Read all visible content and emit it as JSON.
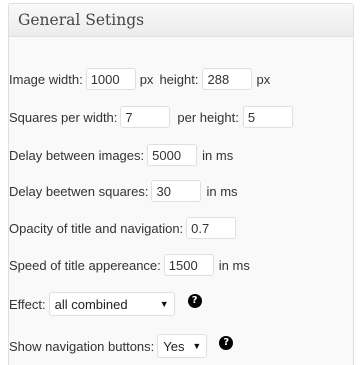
{
  "panel": {
    "title": "General Setings"
  },
  "image_size": {
    "width_label": "Image width:",
    "width_value": "1000",
    "width_unit": "px",
    "height_label": "height:",
    "height_value": "288",
    "height_unit": "px"
  },
  "squares": {
    "per_width_label": "Squares per width:",
    "per_width_value": "7",
    "per_height_label": "per height:",
    "per_height_value": "5"
  },
  "delay_images": {
    "label": "Delay between images:",
    "value": "5000",
    "unit": "in ms"
  },
  "delay_squares": {
    "label": "Delay beetwen squares:",
    "value": "30",
    "unit": "in ms"
  },
  "opacity": {
    "label": "Opacity of title and navigation:",
    "value": "0.7"
  },
  "title_speed": {
    "label": "Speed of title appereance:",
    "value": "1500",
    "unit": "in ms"
  },
  "effect": {
    "label": "Effect:",
    "selected": "all combined",
    "help_icon": "question-circle-icon",
    "help_glyph": "?"
  },
  "nav_buttons": {
    "label": "Show navigation buttons:",
    "selected": "Yes",
    "help_icon": "question-circle-icon",
    "help_glyph": "?"
  }
}
